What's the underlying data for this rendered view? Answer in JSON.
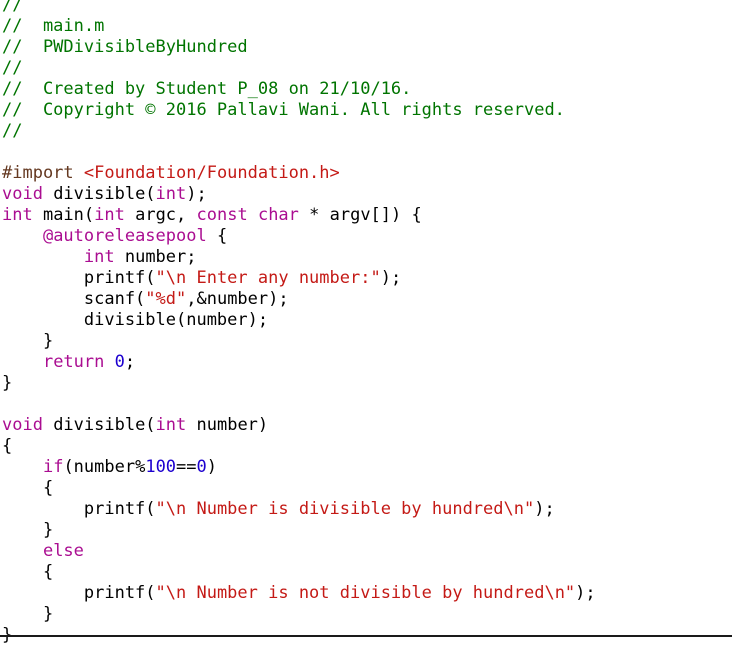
{
  "colors": {
    "plain": "#000000",
    "comment": "#007400",
    "keyword": "#aa0d91",
    "string": "#c41a16",
    "number": "#1c00cf",
    "preprocessor": "#643820"
  },
  "lines": [
    [
      {
        "t": "//",
        "k": "comment"
      }
    ],
    [
      {
        "t": "//  main.m",
        "k": "comment"
      }
    ],
    [
      {
        "t": "//  PWDivisibleByHundred",
        "k": "comment"
      }
    ],
    [
      {
        "t": "//",
        "k": "comment"
      }
    ],
    [
      {
        "t": "//  Created by Student P_08 on 21/10/16.",
        "k": "comment"
      }
    ],
    [
      {
        "t": "//  Copyright © 2016 Pallavi Wani. All rights reserved.",
        "k": "comment"
      }
    ],
    [
      {
        "t": "//",
        "k": "comment"
      }
    ],
    [],
    [
      {
        "t": "#import ",
        "k": "preprocessor"
      },
      {
        "t": "<Foundation/Foundation.h>",
        "k": "string"
      }
    ],
    [
      {
        "t": "void",
        "k": "keyword"
      },
      {
        "t": " divisible(",
        "k": "plain"
      },
      {
        "t": "int",
        "k": "keyword"
      },
      {
        "t": ");",
        "k": "plain"
      }
    ],
    [
      {
        "t": "int",
        "k": "keyword"
      },
      {
        "t": " main(",
        "k": "plain"
      },
      {
        "t": "int",
        "k": "keyword"
      },
      {
        "t": " argc, ",
        "k": "plain"
      },
      {
        "t": "const",
        "k": "keyword"
      },
      {
        "t": " ",
        "k": "plain"
      },
      {
        "t": "char",
        "k": "keyword"
      },
      {
        "t": " * argv[]) {",
        "k": "plain"
      }
    ],
    [
      {
        "t": "    ",
        "k": "plain"
      },
      {
        "t": "@autoreleasepool",
        "k": "keyword"
      },
      {
        "t": " {",
        "k": "plain"
      }
    ],
    [
      {
        "t": "        ",
        "k": "plain"
      },
      {
        "t": "int",
        "k": "keyword"
      },
      {
        "t": " number;",
        "k": "plain"
      }
    ],
    [
      {
        "t": "        printf(",
        "k": "plain"
      },
      {
        "t": "\"\\n Enter any number:\"",
        "k": "string"
      },
      {
        "t": ");",
        "k": "plain"
      }
    ],
    [
      {
        "t": "        scanf(",
        "k": "plain"
      },
      {
        "t": "\"%d\"",
        "k": "string"
      },
      {
        "t": ",&number);",
        "k": "plain"
      }
    ],
    [
      {
        "t": "        divisible(number);",
        "k": "plain"
      }
    ],
    [
      {
        "t": "    }",
        "k": "plain"
      }
    ],
    [
      {
        "t": "    ",
        "k": "plain"
      },
      {
        "t": "return",
        "k": "keyword"
      },
      {
        "t": " ",
        "k": "plain"
      },
      {
        "t": "0",
        "k": "number"
      },
      {
        "t": ";",
        "k": "plain"
      }
    ],
    [
      {
        "t": "}",
        "k": "plain"
      }
    ],
    [],
    [
      {
        "t": "void",
        "k": "keyword"
      },
      {
        "t": " divisible(",
        "k": "plain"
      },
      {
        "t": "int",
        "k": "keyword"
      },
      {
        "t": " number)",
        "k": "plain"
      }
    ],
    [
      {
        "t": "{",
        "k": "plain"
      }
    ],
    [
      {
        "t": "    ",
        "k": "plain"
      },
      {
        "t": "if",
        "k": "keyword"
      },
      {
        "t": "(number%",
        "k": "plain"
      },
      {
        "t": "100",
        "k": "number"
      },
      {
        "t": "==",
        "k": "plain"
      },
      {
        "t": "0",
        "k": "number"
      },
      {
        "t": ")",
        "k": "plain"
      }
    ],
    [
      {
        "t": "    {",
        "k": "plain"
      }
    ],
    [
      {
        "t": "        printf(",
        "k": "plain"
      },
      {
        "t": "\"\\n Number is divisible by hundred\\n\"",
        "k": "string"
      },
      {
        "t": ");",
        "k": "plain"
      }
    ],
    [
      {
        "t": "    }",
        "k": "plain"
      }
    ],
    [
      {
        "t": "    ",
        "k": "plain"
      },
      {
        "t": "else",
        "k": "keyword"
      }
    ],
    [
      {
        "t": "    {",
        "k": "plain"
      }
    ],
    [
      {
        "t": "        printf(",
        "k": "plain"
      },
      {
        "t": "\"\\n Number is not divisible by hundred\\n\"",
        "k": "string"
      },
      {
        "t": ");",
        "k": "plain"
      }
    ],
    [
      {
        "t": "    }",
        "k": "plain"
      }
    ],
    [
      {
        "t": "}",
        "k": "plain"
      }
    ]
  ]
}
